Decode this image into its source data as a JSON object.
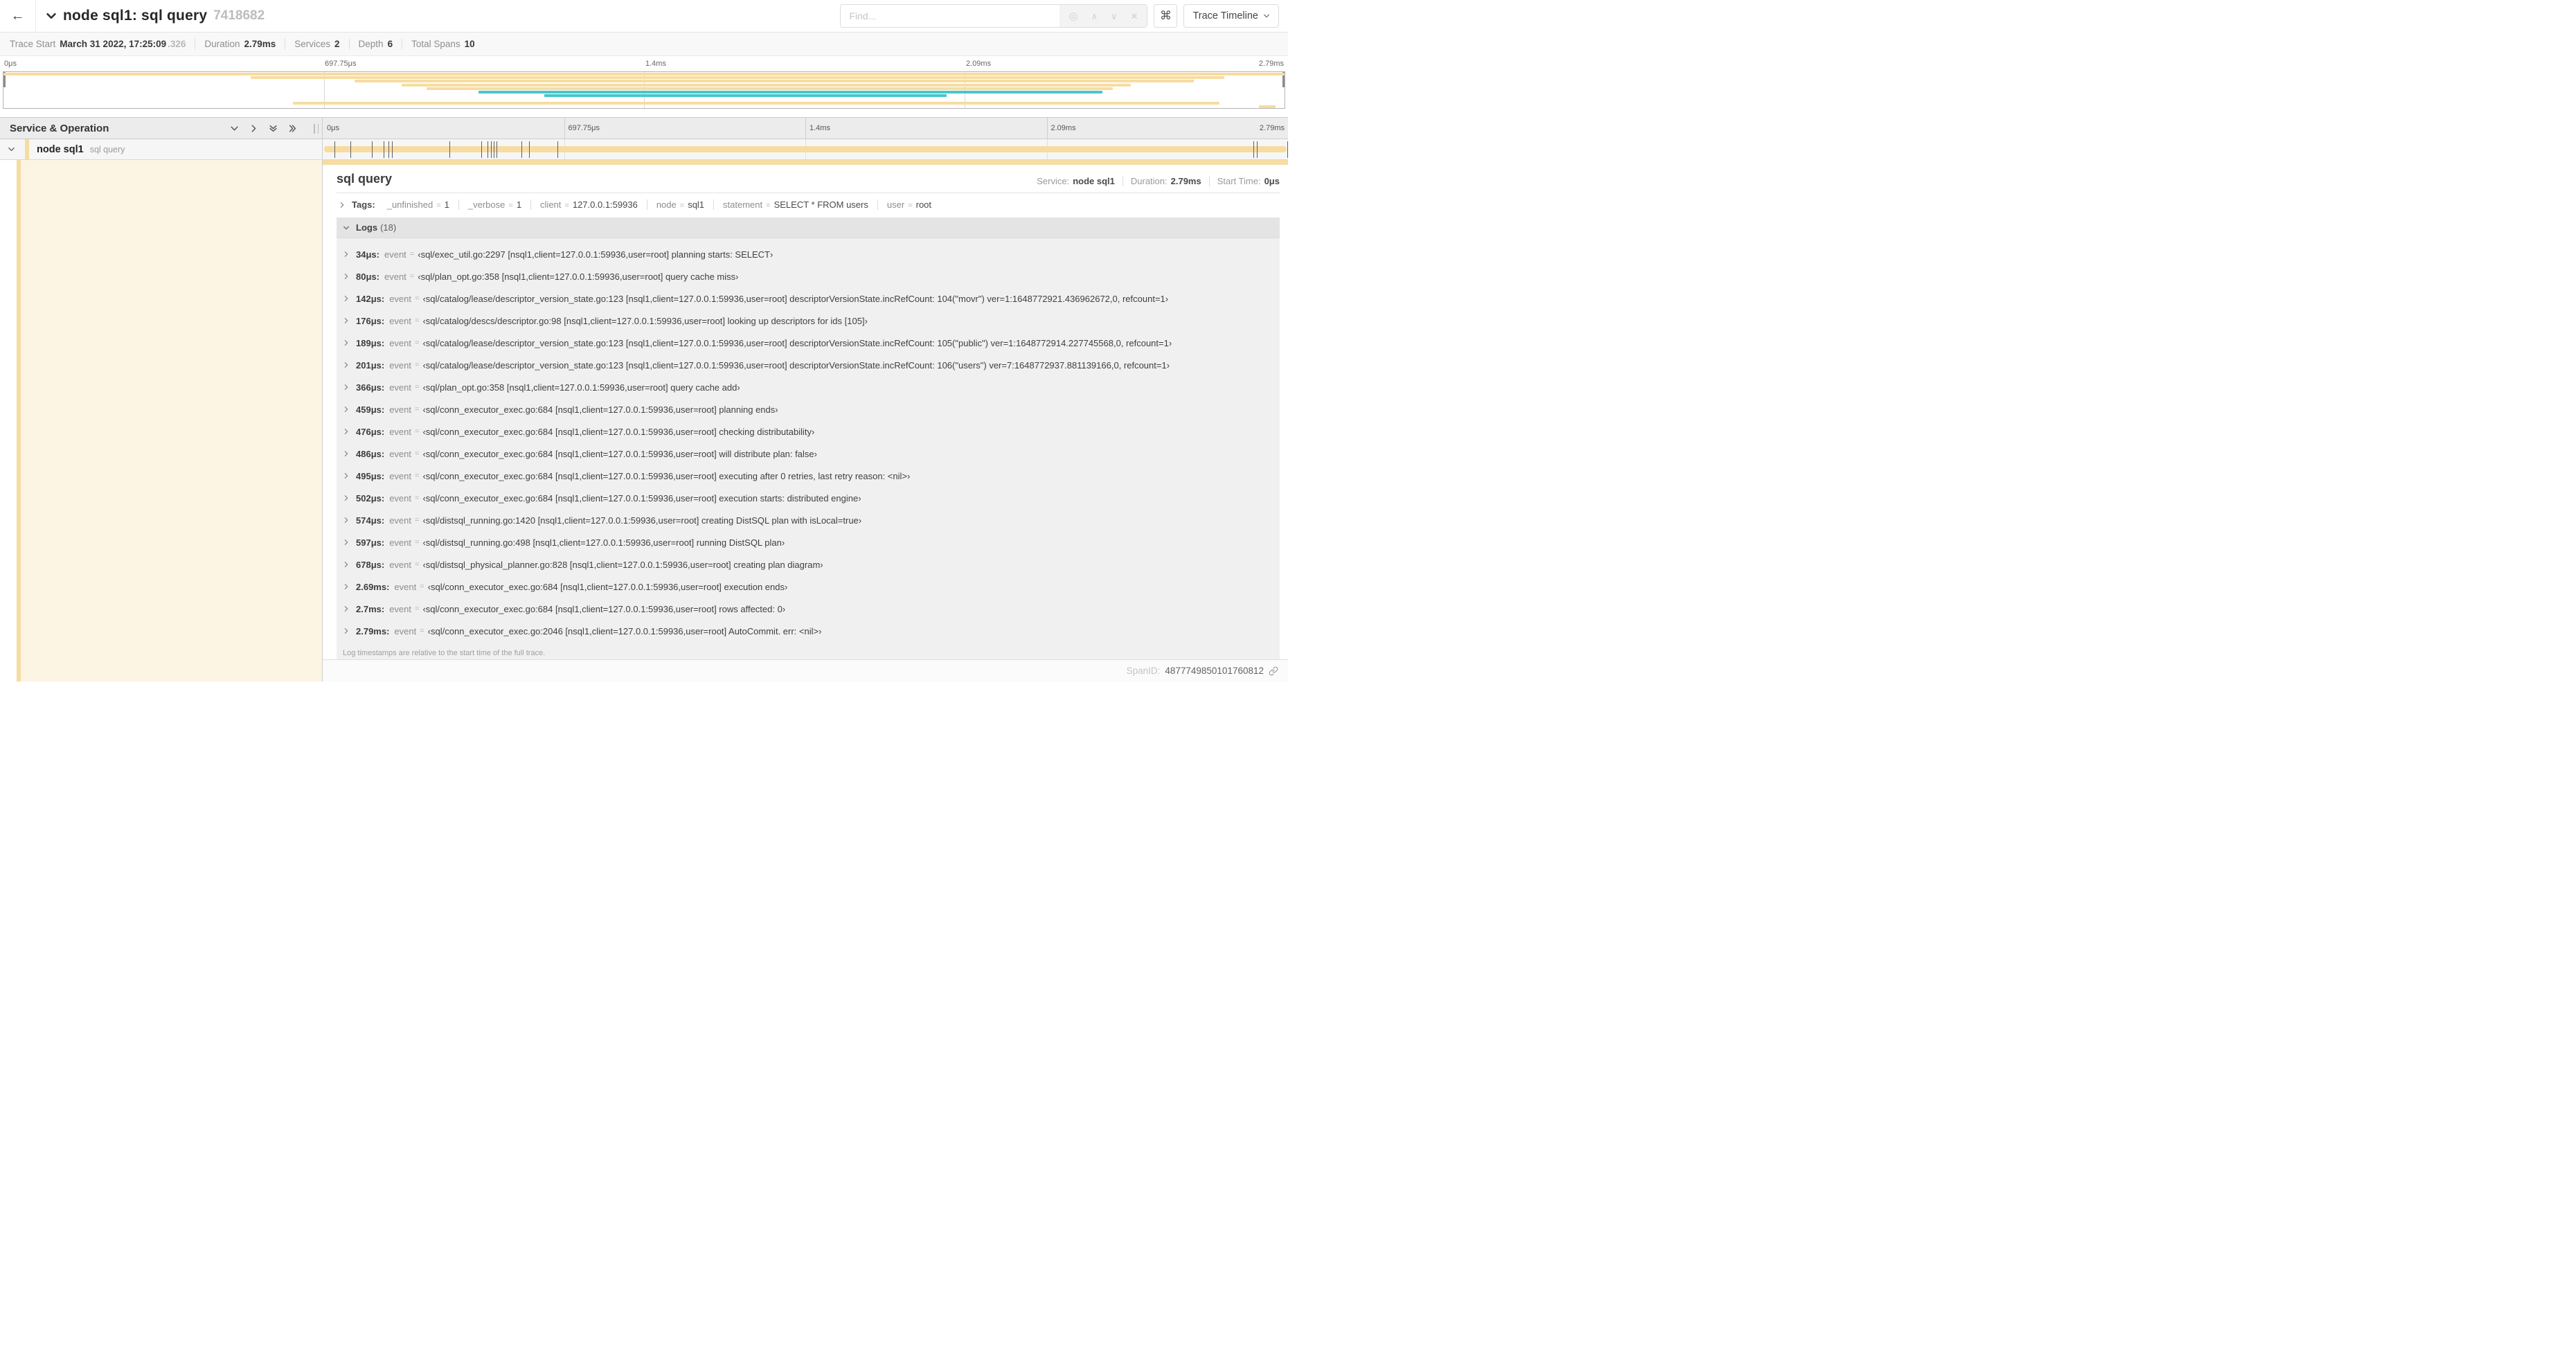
{
  "ui": {
    "equals": "="
  },
  "header": {
    "back_symbol": "←",
    "title": "node sql1: sql query",
    "trace_id": "7418682",
    "find_placeholder": "Find...",
    "locate_symbol": "◎",
    "prev_symbol": "∧",
    "next_symbol": "∨",
    "clear_symbol": "✕",
    "command_symbol": "⌘",
    "view_button": "Trace Timeline"
  },
  "trace_info": [
    {
      "label": "Trace Start",
      "value": "March 31 2022, 17:25:09",
      "suffix": ".326"
    },
    {
      "label": "Duration",
      "value": "2.79ms"
    },
    {
      "label": "Services",
      "value": "2"
    },
    {
      "label": "Depth",
      "value": "6"
    },
    {
      "label": "Total Spans",
      "value": "10"
    }
  ],
  "minimap": {
    "colors": {
      "tan": "#F7DCA1",
      "teal": "#47C6C9",
      "cream": "#FCF5E4"
    },
    "ticks": [
      {
        "label": "0μs",
        "pct": 0
      },
      {
        "label": "697.75μs",
        "pct": 25
      },
      {
        "label": "1.4ms",
        "pct": 50
      },
      {
        "label": "2.09ms",
        "pct": 75
      },
      {
        "label": "2.79ms",
        "pct": 100
      }
    ],
    "bars": [
      {
        "row": 0,
        "color": "tan",
        "start": 0,
        "end": 100
      },
      {
        "row": 1,
        "color": "tan",
        "start": 19.3,
        "end": 95.3
      },
      {
        "row": 2,
        "color": "tan",
        "start": 27.4,
        "end": 92.9
      },
      {
        "row": 3,
        "color": "tan",
        "start": 31.1,
        "end": 88.0
      },
      {
        "row": 4,
        "color": "tan",
        "start": 33.0,
        "end": 86.6
      },
      {
        "row": 5,
        "color": "teal",
        "start": 37.1,
        "end": 85.8
      },
      {
        "row": 6,
        "color": "teal",
        "start": 42.2,
        "end": 73.6
      },
      {
        "row": 8,
        "color": "tan",
        "start": 22.6,
        "end": 94.9
      },
      {
        "row": 9,
        "color": "tan",
        "start": 98.0,
        "end": 99.3
      }
    ]
  },
  "timeline": {
    "left_header": "Service & Operation",
    "ticks": [
      {
        "label": "0μs",
        "pct": 0
      },
      {
        "label": "697.75μs",
        "pct": 25
      },
      {
        "label": "1.4ms",
        "pct": 50
      },
      {
        "label": "2.09ms",
        "pct": 75
      },
      {
        "label": "2.79ms",
        "pct": 100
      }
    ],
    "row": {
      "service": "node sql1",
      "operation": "sql query"
    },
    "log_markers_pct": [
      1.22,
      2.87,
      5.09,
      6.31,
      6.78,
      7.2,
      13.12,
      16.45,
      17.06,
      17.42,
      17.74,
      18.0,
      20.57,
      21.4,
      24.3,
      96.42,
      96.77,
      99.95
    ]
  },
  "detail": {
    "title": "sql query",
    "meta": [
      {
        "label": "Service:",
        "value": "node sql1"
      },
      {
        "label": "Duration:",
        "value": "2.79ms"
      },
      {
        "label": "Start Time:",
        "value": "0μs"
      }
    ],
    "tags_label": "Tags:",
    "tags": [
      {
        "key": "_unfinished",
        "value": "1"
      },
      {
        "key": "_verbose",
        "value": "1"
      },
      {
        "key": "client",
        "value": "127.0.0.1:59936"
      },
      {
        "key": "node",
        "value": "sql1"
      },
      {
        "key": "statement",
        "value": "SELECT * FROM users"
      },
      {
        "key": "user",
        "value": "root"
      }
    ],
    "logs_label": "Logs",
    "logs_count": "(18)",
    "logs": [
      {
        "time": "34μs:",
        "key": "event",
        "value": "‹sql/exec_util.go:2297 [nsql1,client=127.0.0.1:59936,user=root] planning starts: SELECT›"
      },
      {
        "time": "80μs:",
        "key": "event",
        "value": "‹sql/plan_opt.go:358 [nsql1,client=127.0.0.1:59936,user=root] query cache miss›"
      },
      {
        "time": "142μs:",
        "key": "event",
        "value": "‹sql/catalog/lease/descriptor_version_state.go:123 [nsql1,client=127.0.0.1:59936,user=root] descriptorVersionState.incRefCount: 104(\"movr\") ver=1:1648772921.436962672,0, refcount=1›"
      },
      {
        "time": "176μs:",
        "key": "event",
        "value": "‹sql/catalog/descs/descriptor.go:98 [nsql1,client=127.0.0.1:59936,user=root] looking up descriptors for ids [105]›"
      },
      {
        "time": "189μs:",
        "key": "event",
        "value": "‹sql/catalog/lease/descriptor_version_state.go:123 [nsql1,client=127.0.0.1:59936,user=root] descriptorVersionState.incRefCount: 105(\"public\") ver=1:1648772914.227745568,0, refcount=1›"
      },
      {
        "time": "201μs:",
        "key": "event",
        "value": "‹sql/catalog/lease/descriptor_version_state.go:123 [nsql1,client=127.0.0.1:59936,user=root] descriptorVersionState.incRefCount: 106(\"users\") ver=7:1648772937.881139166,0, refcount=1›"
      },
      {
        "time": "366μs:",
        "key": "event",
        "value": "‹sql/plan_opt.go:358 [nsql1,client=127.0.0.1:59936,user=root] query cache add›"
      },
      {
        "time": "459μs:",
        "key": "event",
        "value": "‹sql/conn_executor_exec.go:684 [nsql1,client=127.0.0.1:59936,user=root] planning ends›"
      },
      {
        "time": "476μs:",
        "key": "event",
        "value": "‹sql/conn_executor_exec.go:684 [nsql1,client=127.0.0.1:59936,user=root] checking distributability›"
      },
      {
        "time": "486μs:",
        "key": "event",
        "value": "‹sql/conn_executor_exec.go:684 [nsql1,client=127.0.0.1:59936,user=root] will distribute plan: false›"
      },
      {
        "time": "495μs:",
        "key": "event",
        "value": "‹sql/conn_executor_exec.go:684 [nsql1,client=127.0.0.1:59936,user=root] executing after 0 retries, last retry reason: <nil>›"
      },
      {
        "time": "502μs:",
        "key": "event",
        "value": "‹sql/conn_executor_exec.go:684 [nsql1,client=127.0.0.1:59936,user=root] execution starts: distributed engine›"
      },
      {
        "time": "574μs:",
        "key": "event",
        "value": "‹sql/distsql_running.go:1420 [nsql1,client=127.0.0.1:59936,user=root] creating DistSQL plan with isLocal=true›"
      },
      {
        "time": "597μs:",
        "key": "event",
        "value": "‹sql/distsql_running.go:498 [nsql1,client=127.0.0.1:59936,user=root] running DistSQL plan›"
      },
      {
        "time": "678μs:",
        "key": "event",
        "value": "‹sql/distsql_physical_planner.go:828 [nsql1,client=127.0.0.1:59936,user=root] creating plan diagram›"
      },
      {
        "time": "2.69ms:",
        "key": "event",
        "value": "‹sql/conn_executor_exec.go:684 [nsql1,client=127.0.0.1:59936,user=root] execution ends›"
      },
      {
        "time": "2.7ms:",
        "key": "event",
        "value": "‹sql/conn_executor_exec.go:684 [nsql1,client=127.0.0.1:59936,user=root] rows affected: 0›"
      },
      {
        "time": "2.79ms:",
        "key": "event",
        "value": "‹sql/conn_executor_exec.go:2046 [nsql1,client=127.0.0.1:59936,user=root] AutoCommit. err: <nil>›"
      }
    ],
    "footnote": "Log timestamps are relative to the start time of the full trace.",
    "footer": {
      "label": "SpanID:",
      "value": "4877749850101760812"
    }
  }
}
